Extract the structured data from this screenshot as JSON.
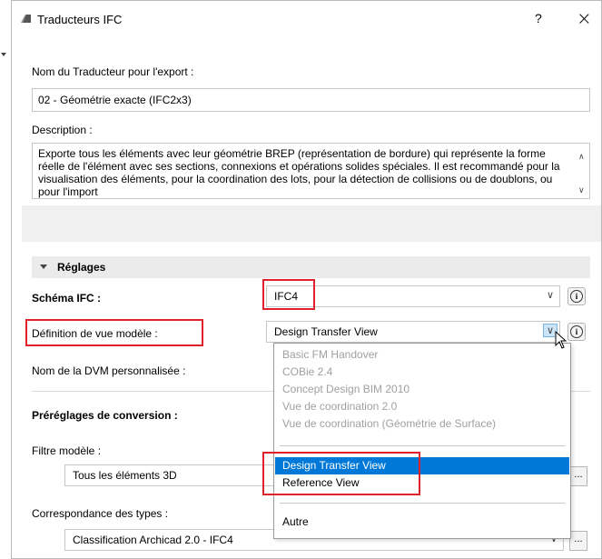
{
  "titlebar": {
    "title": "Traducteurs IFC",
    "help_label": "?",
    "close_label": "×"
  },
  "translator_name": {
    "label": "Nom du Traducteur pour l'export :",
    "value": "02 - Géométrie exacte (IFC2x3)"
  },
  "description": {
    "label": "Description :",
    "text": "Exporte tous les éléments avec leur géométrie BREP (représentation de bordure) qui représente la forme réelle de l'élément avec ses sections, connexions et opérations solides spéciales. Il est recommandé pour la visualisation des éléments, pour la coordination des lots, pour la détection de collisions ou de doublons, ou pour l'import"
  },
  "settings": {
    "section_label": "Réglages",
    "ifc_schema": {
      "label": "Schéma IFC :",
      "value": "IFC4"
    },
    "mvd": {
      "label": "Définition de vue modèle :",
      "value": "Design Transfer View"
    },
    "custom_mvd": {
      "label": "Nom de la DVM personnalisée :"
    },
    "presets": {
      "label": "Préréglages de conversion :"
    },
    "model_filter": {
      "label": "Filtre modèle :",
      "value": "Tous les éléments 3D"
    },
    "type_mapping": {
      "label": "Correspondance des types :",
      "value": "Classification Archicad 2.0 - IFC4"
    },
    "dots_label": "..."
  },
  "dropdown": {
    "disabled_items": [
      "Basic FM Handover",
      "COBie 2.4",
      "Concept Design BIM 2010",
      "Vue de coordination 2.0",
      "Vue de coordination (Géométrie de Surface)"
    ],
    "selected_item": "Design Transfer View",
    "reference_item": "Reference View",
    "other_item": "Autre"
  },
  "icons": {
    "info": "i",
    "chevron": "∨",
    "scroll_up": "∧",
    "scroll_down": "∨"
  },
  "colors": {
    "highlight": "#e0202a",
    "selection": "#0078d7"
  }
}
